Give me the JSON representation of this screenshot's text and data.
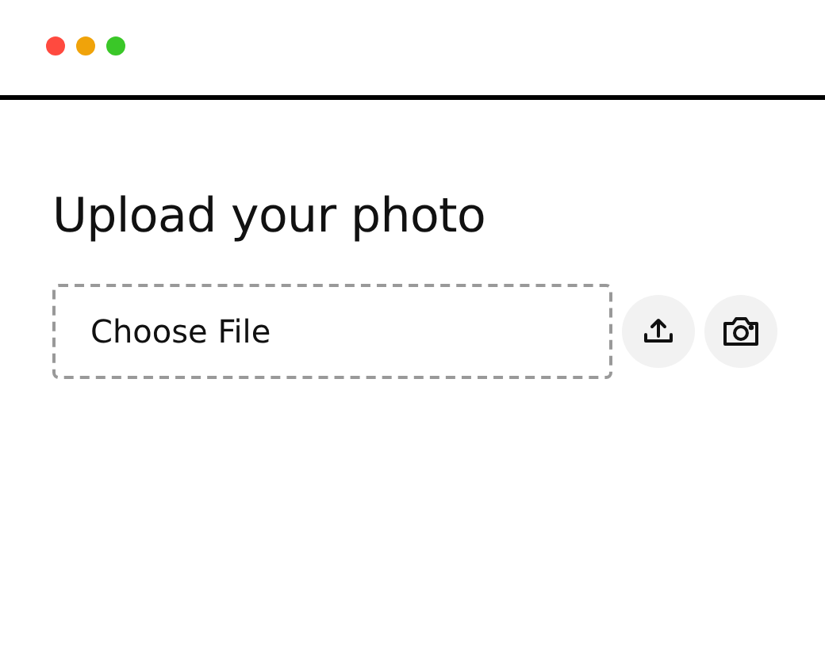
{
  "window_controls": [
    {
      "color": "#ff4a3f"
    },
    {
      "color": "#f0a30a"
    },
    {
      "color": "#3ac728"
    }
  ],
  "title": "Upload your photo",
  "file_picker": {
    "label": "Choose File"
  },
  "actions": [
    {
      "kind": "upload"
    },
    {
      "kind": "camera"
    }
  ]
}
